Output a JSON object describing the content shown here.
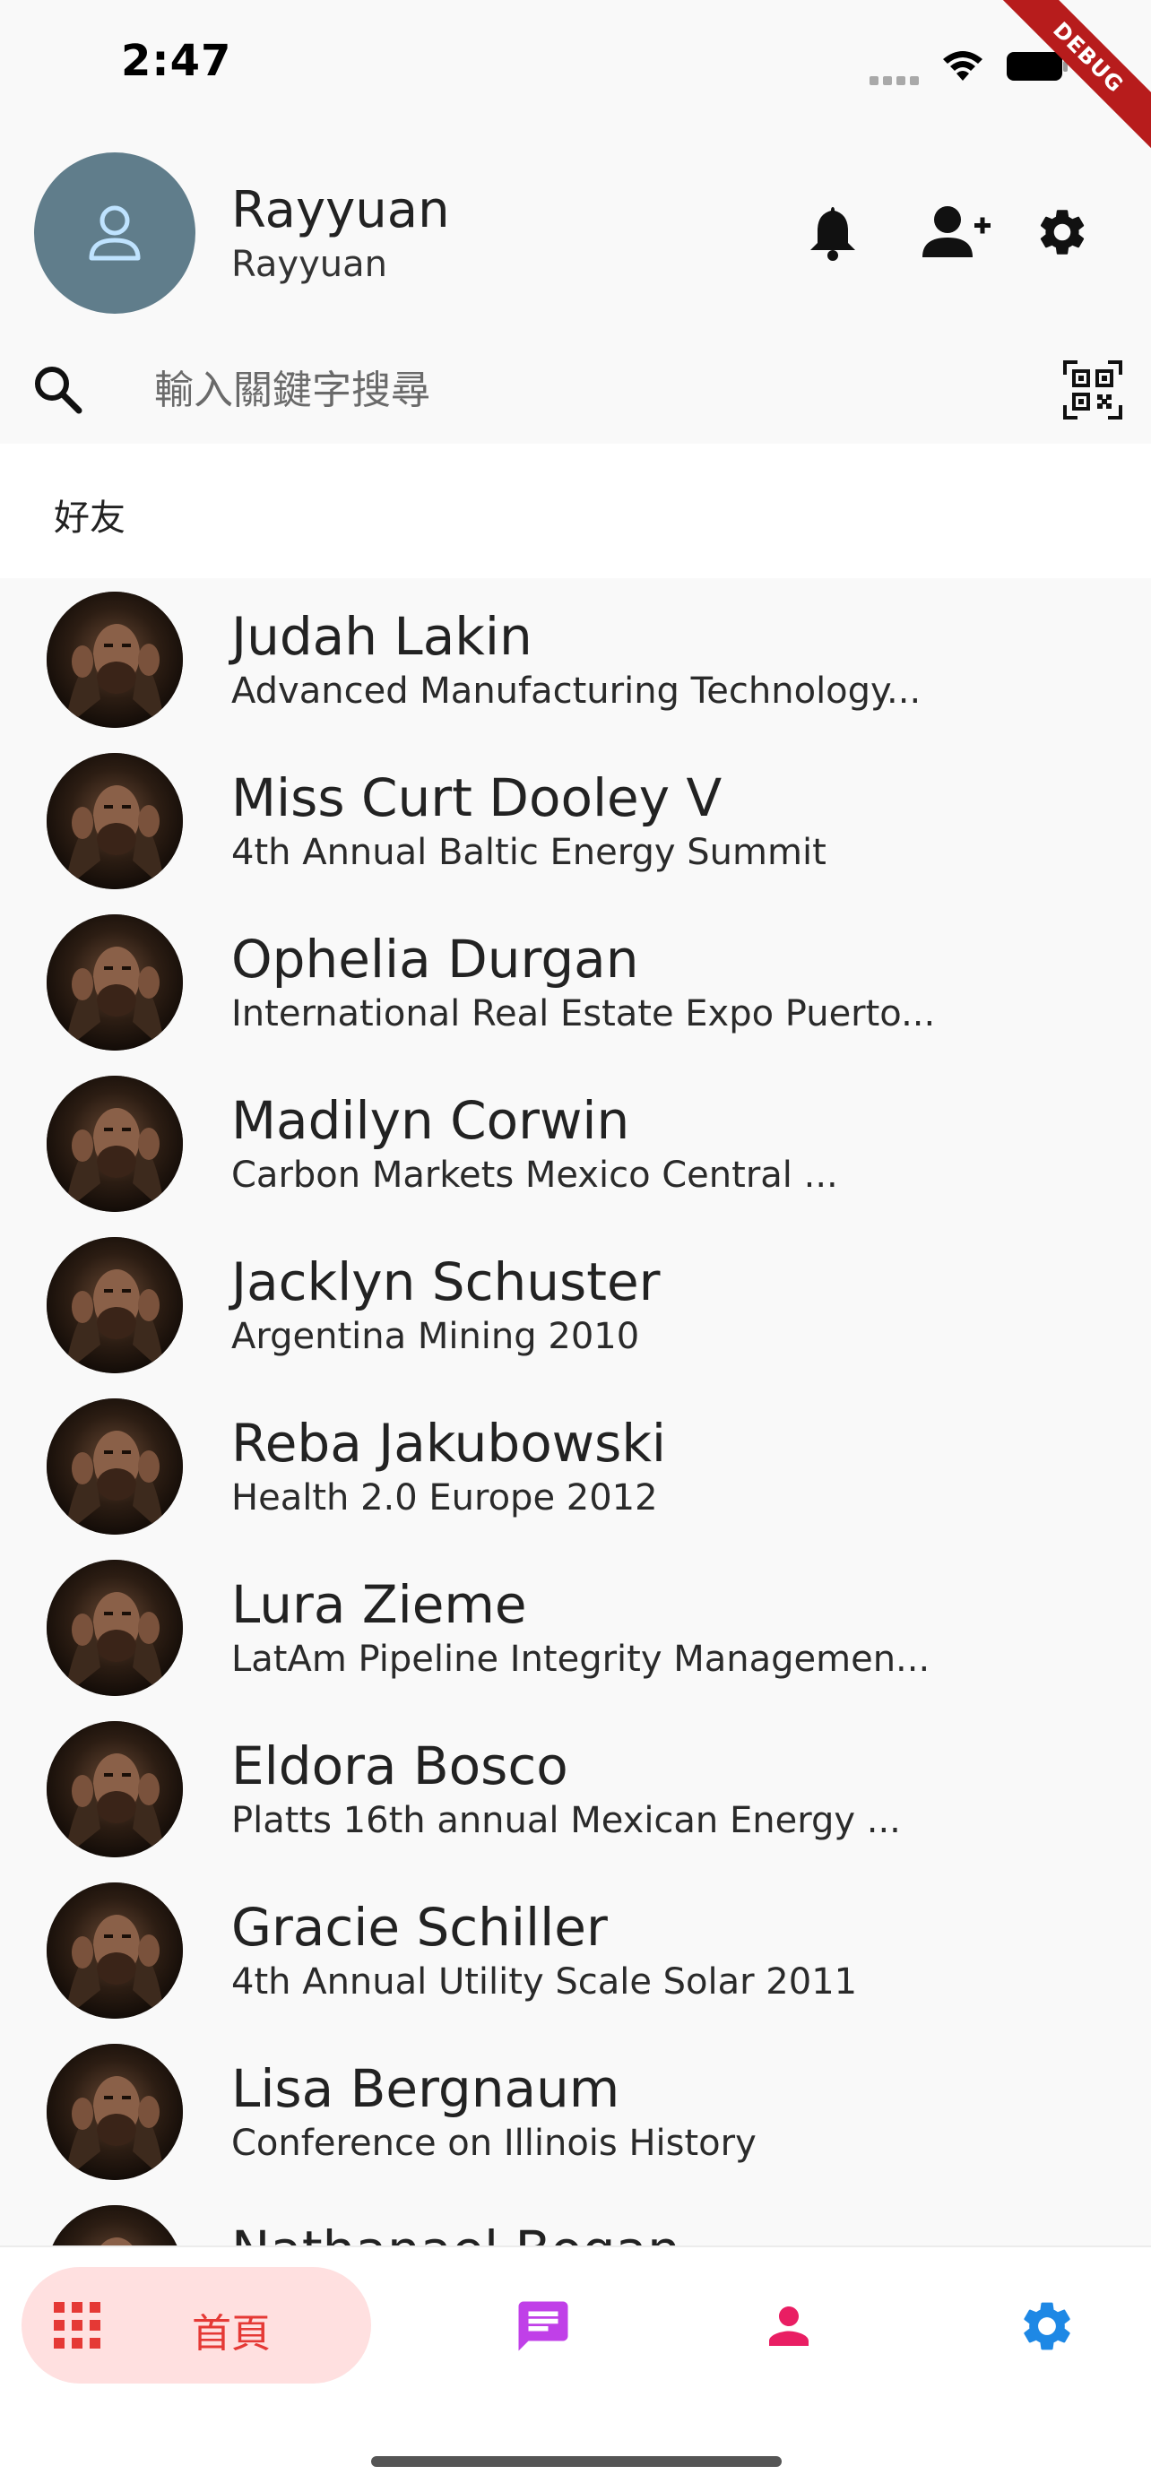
{
  "status_bar": {
    "time": "2:47",
    "debug_label": "DEBUG"
  },
  "profile": {
    "name": "Rayyuan",
    "subtitle": "Rayyuan"
  },
  "header_icons": [
    "bell-icon",
    "add-person-icon",
    "settings-icon"
  ],
  "search": {
    "placeholder": "輸入關鍵字搜尋"
  },
  "section": {
    "title": "好友"
  },
  "friends": [
    {
      "name": "Judah Lakin",
      "subtitle": "Advanced Manufacturing Technology..."
    },
    {
      "name": "Miss Curt Dooley V",
      "subtitle": "4th Annual Baltic Energy Summit"
    },
    {
      "name": "Ophelia Durgan",
      "subtitle": "International Real Estate Expo Puerto..."
    },
    {
      "name": "Madilyn Corwin",
      "subtitle": "Carbon Markets Mexico Central ..."
    },
    {
      "name": "Jacklyn Schuster",
      "subtitle": "Argentina Mining 2010"
    },
    {
      "name": "Reba Jakubowski",
      "subtitle": "Health 2.0 Europe 2012"
    },
    {
      "name": "Lura Zieme",
      "subtitle": "LatAm Pipeline Integrity Managemen..."
    },
    {
      "name": "Eldora Bosco",
      "subtitle": "Platts 16th annual Mexican Energy ..."
    },
    {
      "name": "Gracie Schiller",
      "subtitle": "4th Annual Utility Scale Solar 2011"
    },
    {
      "name": "Lisa Bergnaum",
      "subtitle": "Conference on Illinois History"
    },
    {
      "name": "Nathanael Bogan",
      "subtitle": ""
    }
  ],
  "bottom_nav": {
    "home_label": "首頁",
    "colors": {
      "home": "#e53935",
      "chat": "#c040e8",
      "profile": "#e91e63",
      "settings": "#1e88e5"
    }
  }
}
